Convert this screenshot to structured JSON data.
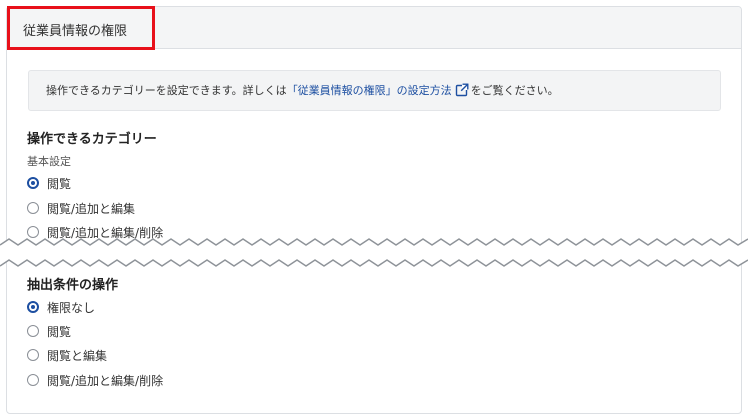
{
  "panel": {
    "title": "従業員情報の権限"
  },
  "info": {
    "text_before": "操作できるカテゴリーを設定できます。詳しくは",
    "link_text": "「従業員情報の権限」の設定方法",
    "text_after": "をご覧ください。",
    "link_icon": "external-link-icon"
  },
  "categories": {
    "title": "操作できるカテゴリー",
    "group_label": "基本設定",
    "options": [
      {
        "label": "閲覧",
        "checked": true
      },
      {
        "label": "閲覧/追加と編集",
        "checked": false
      },
      {
        "label": "閲覧/追加と編集/削除",
        "checked": false
      }
    ]
  },
  "filter": {
    "title": "抽出条件の操作",
    "options": [
      {
        "label": "権限なし",
        "checked": true
      },
      {
        "label": "閲覧",
        "checked": false
      },
      {
        "label": "閲覧と編集",
        "checked": false
      },
      {
        "label": "閲覧/追加と編集/削除",
        "checked": false
      }
    ]
  },
  "colors": {
    "accent": "#1d4fa1",
    "highlight": "#e8101a",
    "header_bg": "#f4f5f6",
    "info_bg": "#f3f4f5"
  }
}
